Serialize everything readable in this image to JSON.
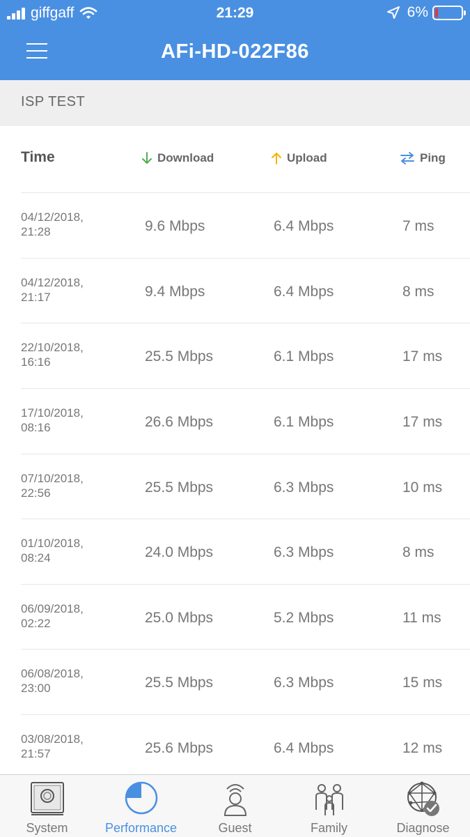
{
  "status_bar": {
    "carrier": "giffgaff",
    "time": "21:29",
    "battery": "6%"
  },
  "header": {
    "title": "AFi-HD-022F86"
  },
  "section": {
    "title": "ISP TEST"
  },
  "table": {
    "headers": {
      "time": "Time",
      "download": "Download",
      "upload": "Upload",
      "ping": "Ping"
    },
    "rows": [
      {
        "date": "04/12/2018,",
        "clock": "21:28",
        "download": "9.6 Mbps",
        "upload": "6.4 Mbps",
        "ping": "7 ms"
      },
      {
        "date": "04/12/2018,",
        "clock": "21:17",
        "download": "9.4 Mbps",
        "upload": "6.4 Mbps",
        "ping": "8 ms"
      },
      {
        "date": "22/10/2018,",
        "clock": "16:16",
        "download": "25.5 Mbps",
        "upload": "6.1 Mbps",
        "ping": "17 ms"
      },
      {
        "date": "17/10/2018,",
        "clock": "08:16",
        "download": "26.6 Mbps",
        "upload": "6.1 Mbps",
        "ping": "17 ms"
      },
      {
        "date": "07/10/2018,",
        "clock": "22:56",
        "download": "25.5 Mbps",
        "upload": "6.3 Mbps",
        "ping": "10 ms"
      },
      {
        "date": "01/10/2018,",
        "clock": "08:24",
        "download": "24.0 Mbps",
        "upload": "6.3 Mbps",
        "ping": "8 ms"
      },
      {
        "date": "06/09/2018,",
        "clock": "02:22",
        "download": "25.0 Mbps",
        "upload": "5.2 Mbps",
        "ping": "11 ms"
      },
      {
        "date": "06/08/2018,",
        "clock": "23:00",
        "download": "25.5 Mbps",
        "upload": "6.3 Mbps",
        "ping": "15 ms"
      },
      {
        "date": "03/08/2018,",
        "clock": "21:57",
        "download": "25.6 Mbps",
        "upload": "6.4 Mbps",
        "ping": "12 ms"
      }
    ]
  },
  "tabs": [
    {
      "label": "System",
      "icon": "system-icon"
    },
    {
      "label": "Performance",
      "icon": "performance-icon",
      "active": true
    },
    {
      "label": "Guest",
      "icon": "guest-icon"
    },
    {
      "label": "Family",
      "icon": "family-icon"
    },
    {
      "label": "Diagnose",
      "icon": "diagnose-icon"
    }
  ],
  "colors": {
    "accent": "#4a90e2",
    "download": "#4caf50",
    "upload": "#f5b400",
    "ping": "#4a90e2",
    "battery_low": "#e03a3a"
  }
}
